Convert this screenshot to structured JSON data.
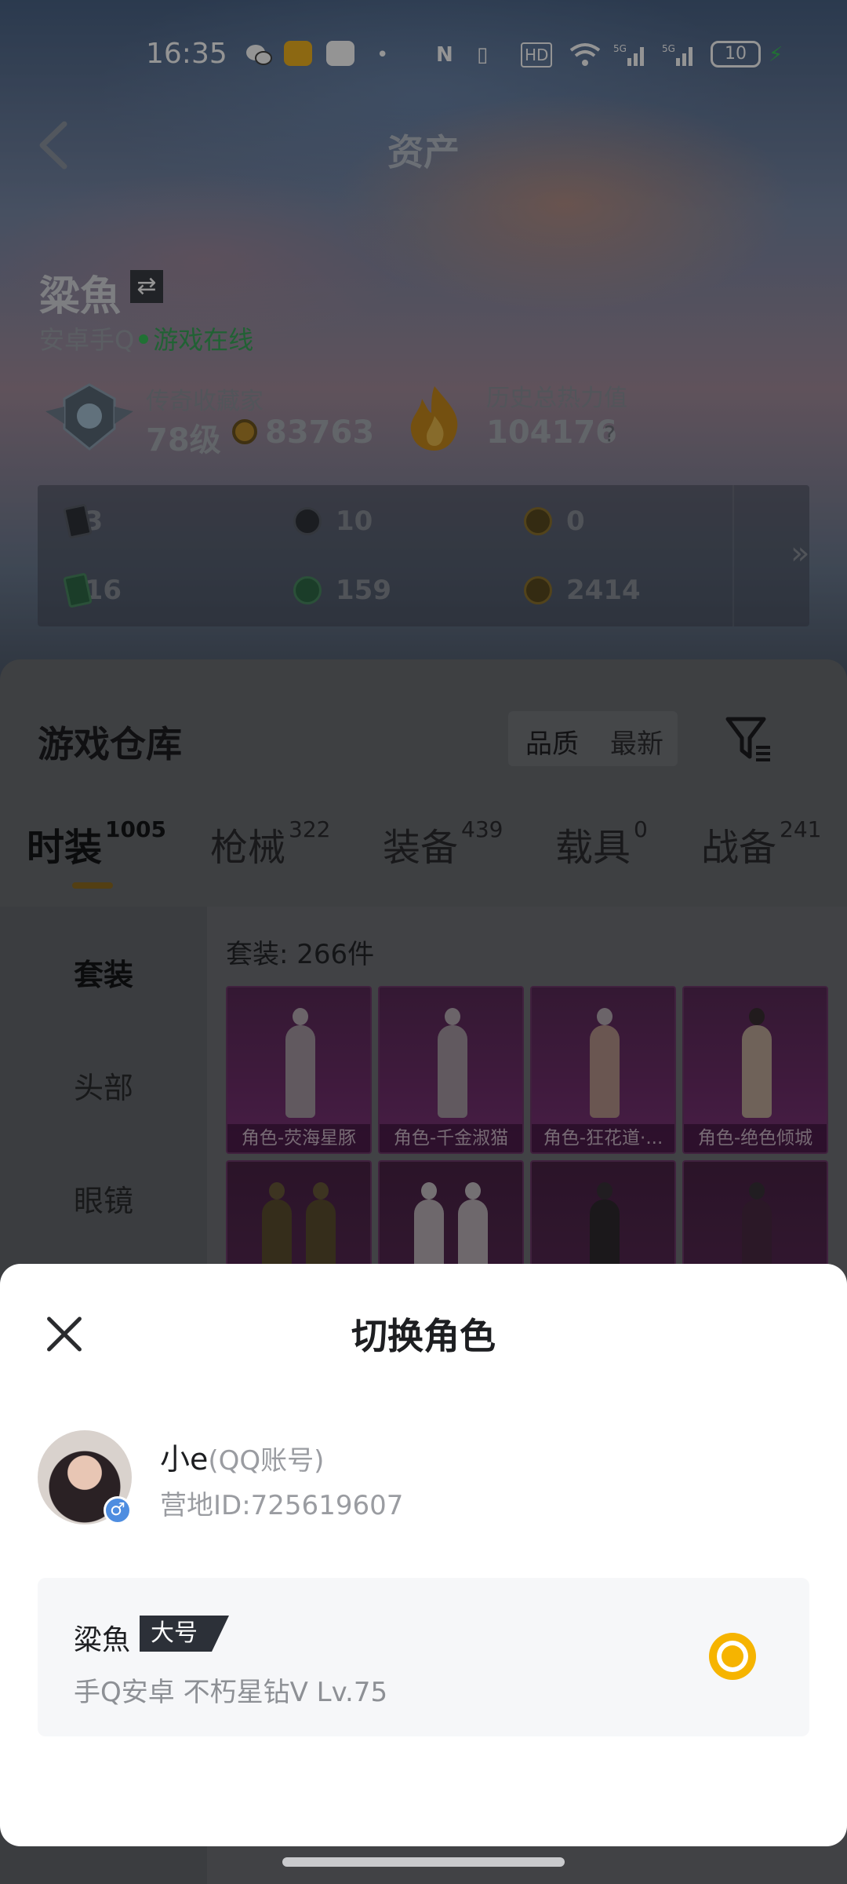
{
  "status_bar": {
    "time": "16:35",
    "battery": "10",
    "icons": [
      "wechat-icon",
      "book-app-icon",
      "mobile-app-icon",
      "dot-icon",
      "nfc-icon",
      "vibrate-icon",
      "hd-icon",
      "wifi-icon",
      "signal-5g-icon",
      "signal-5g-icon",
      "charging-icon"
    ]
  },
  "header": {
    "title": "资产",
    "back_icon": "chevron-left-icon"
  },
  "profile": {
    "name": "粱魚",
    "platform": "安卓手Q",
    "online": "游戏在线",
    "rank_label": "传奇收藏家",
    "rank_level": "78级",
    "coins": "83763",
    "heat_label": "历史总热力值",
    "heat_value": "104176",
    "heat_help": "?"
  },
  "stats": [
    {
      "icon": "card-icon",
      "value": "23"
    },
    {
      "icon": "medal-icon",
      "value": "10"
    },
    {
      "icon": "gold-medal-icon",
      "value": "0"
    },
    {
      "icon": "green-card-icon",
      "value": "516"
    },
    {
      "icon": "orb-icon",
      "value": "159"
    },
    {
      "icon": "bronze-orb-icon",
      "value": "2414"
    }
  ],
  "stats_more": "»",
  "warehouse": {
    "title": "游戏仓库",
    "quality": "品质",
    "newest": "最新",
    "tabs": [
      {
        "label": "时装",
        "count": "1005"
      },
      {
        "label": "枪械",
        "count": "322"
      },
      {
        "label": "装备",
        "count": "439"
      },
      {
        "label": "载具",
        "count": "0"
      },
      {
        "label": "战备",
        "count": "241"
      }
    ],
    "side": [
      "套装",
      "头部",
      "眼镜"
    ],
    "count_label": "套装: 266件",
    "items": [
      "角色-荧海星豚",
      "角色-千金淑猫",
      "角色-狂花道·...",
      "角色-绝色倾城"
    ]
  },
  "sheet": {
    "title": "切换角色",
    "user_name": "小e",
    "account_type": "(QQ账号)",
    "camp_id": "营地ID:725619607",
    "gender": "♂",
    "role": {
      "name": "粱魚",
      "tag": "大号",
      "info": "手Q安卓  不朽星钻V  Lv.75"
    }
  },
  "colors": {
    "accent": "#f6b400",
    "online": "#3ac35a",
    "tab_indicator": "#8f6d22",
    "card_purple": "#6e2e6a"
  }
}
